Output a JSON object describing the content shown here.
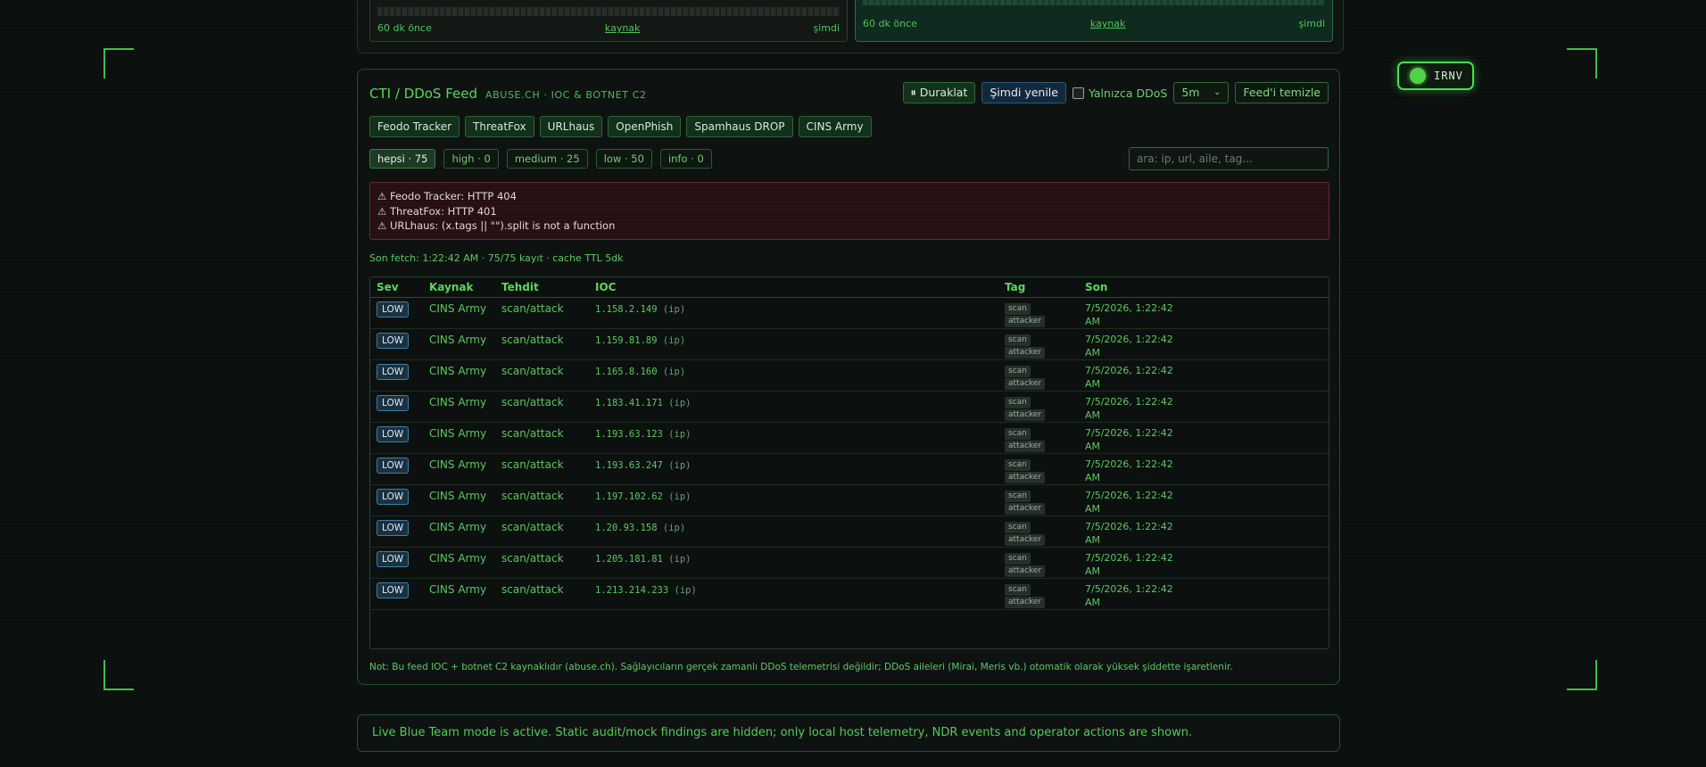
{
  "top_cards": {
    "left": {
      "start": "60 dk önce",
      "source": "kaynak",
      "end": "şimdi"
    },
    "right": {
      "start": "60 dk önce",
      "source": "kaynak",
      "end": "şimdi"
    }
  },
  "toggle": {
    "label": "IRNV",
    "state": "on"
  },
  "panel": {
    "title": "CTI / DDoS Feed",
    "subtitle": "ABUSE.CH · IOC & BOTNET C2",
    "controls": {
      "pause": "⏸ Duraklat",
      "refresh": "Şimdi yenile",
      "ddos_only": "Yalnızca DDoS",
      "interval": "5m",
      "clear": "Feed'i temizle"
    },
    "sources": [
      "Feodo Tracker",
      "ThreatFox",
      "URLhaus",
      "OpenPhish",
      "Spamhaus DROP",
      "CINS Army"
    ],
    "filters": [
      {
        "label": "hepsi · 75",
        "active": true
      },
      {
        "label": "high · 0",
        "active": false
      },
      {
        "label": "medium · 25",
        "active": false
      },
      {
        "label": "low · 50",
        "active": false
      },
      {
        "label": "info · 0",
        "active": false
      }
    ],
    "search_placeholder": "ara: ip, url, aile, tag...",
    "errors": [
      "⚠ Feodo Tracker: HTTP 404",
      "⚠ ThreatFox: HTTP 401",
      "⚠ URLhaus: (x.tags || \"\").split is not a function"
    ],
    "fetch_status": "Son fetch: 1:22:42 AM · 75/75 kayıt · cache TTL 5dk",
    "table": {
      "headers": [
        "Sev",
        "Kaynak",
        "Tehdit",
        "IOC",
        "Tag",
        "Son"
      ],
      "rows": [
        {
          "sev": "LOW",
          "source": "CINS Army",
          "threat": "scan/attack",
          "ioc": "1.158.2.149",
          "ioc_type": "(ip)",
          "tags": [
            "scan",
            "attacker"
          ],
          "time1": "7/5/2026, 1:22:42",
          "time2": "AM"
        },
        {
          "sev": "LOW",
          "source": "CINS Army",
          "threat": "scan/attack",
          "ioc": "1.159.81.89",
          "ioc_type": "(ip)",
          "tags": [
            "scan",
            "attacker"
          ],
          "time1": "7/5/2026, 1:22:42",
          "time2": "AM"
        },
        {
          "sev": "LOW",
          "source": "CINS Army",
          "threat": "scan/attack",
          "ioc": "1.165.8.160",
          "ioc_type": "(ip)",
          "tags": [
            "scan",
            "attacker"
          ],
          "time1": "7/5/2026, 1:22:42",
          "time2": "AM"
        },
        {
          "sev": "LOW",
          "source": "CINS Army",
          "threat": "scan/attack",
          "ioc": "1.183.41.171",
          "ioc_type": "(ip)",
          "tags": [
            "scan",
            "attacker"
          ],
          "time1": "7/5/2026, 1:22:42",
          "time2": "AM"
        },
        {
          "sev": "LOW",
          "source": "CINS Army",
          "threat": "scan/attack",
          "ioc": "1.193.63.123",
          "ioc_type": "(ip)",
          "tags": [
            "scan",
            "attacker"
          ],
          "time1": "7/5/2026, 1:22:42",
          "time2": "AM"
        },
        {
          "sev": "LOW",
          "source": "CINS Army",
          "threat": "scan/attack",
          "ioc": "1.193.63.247",
          "ioc_type": "(ip)",
          "tags": [
            "scan",
            "attacker"
          ],
          "time1": "7/5/2026, 1:22:42",
          "time2": "AM"
        },
        {
          "sev": "LOW",
          "source": "CINS Army",
          "threat": "scan/attack",
          "ioc": "1.197.102.62",
          "ioc_type": "(ip)",
          "tags": [
            "scan",
            "attacker"
          ],
          "time1": "7/5/2026, 1:22:42",
          "time2": "AM"
        },
        {
          "sev": "LOW",
          "source": "CINS Army",
          "threat": "scan/attack",
          "ioc": "1.20.93.158",
          "ioc_type": "(ip)",
          "tags": [
            "scan",
            "attacker"
          ],
          "time1": "7/5/2026, 1:22:42",
          "time2": "AM"
        },
        {
          "sev": "LOW",
          "source": "CINS Army",
          "threat": "scan/attack",
          "ioc": "1.205.181.81",
          "ioc_type": "(ip)",
          "tags": [
            "scan",
            "attacker"
          ],
          "time1": "7/5/2026, 1:22:42",
          "time2": "AM"
        },
        {
          "sev": "LOW",
          "source": "CINS Army",
          "threat": "scan/attack",
          "ioc": "1.213.214.233",
          "ioc_type": "(ip)",
          "tags": [
            "scan",
            "attacker"
          ],
          "time1": "7/5/2026, 1:22:42",
          "time2": "AM"
        }
      ]
    },
    "note": "Not: Bu feed IOC + botnet C2 kaynaklıdır (abuse.ch). Sağlayıcıların gerçek zamanlı DDoS telemetrisi değildir; DDoS aileleri (Mirai, Meris vb.) otomatik olarak yüksek şiddette işaretlenir."
  },
  "status_bar": "Live Blue Team mode is active. Static audit/mock findings are hidden; only local host telemetry, NDR events and operator actions are shown.",
  "colors": {
    "accent": "#5cd65a",
    "error_border": "#6b2630",
    "sev_low": "#3b7fa8"
  }
}
